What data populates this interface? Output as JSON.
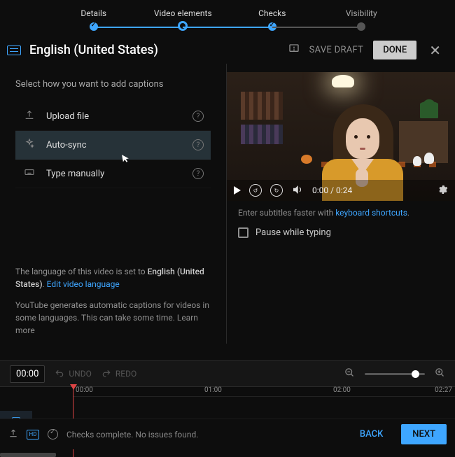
{
  "stepper": {
    "steps": [
      {
        "label": "Details",
        "state": "done"
      },
      {
        "label": "Video elements",
        "state": "current"
      },
      {
        "label": "Checks",
        "state": "done"
      },
      {
        "label": "Visibility",
        "state": "pending"
      }
    ]
  },
  "header": {
    "title": "English (United States)",
    "save_draft": "SAVE DRAFT",
    "done": "DONE"
  },
  "left": {
    "instruction": "Select how you want to add captions",
    "options": {
      "upload": "Upload file",
      "autosync": "Auto-sync",
      "manual": "Type manually"
    },
    "lang_note_prefix": "The language of this video is set to ",
    "lang_note_lang": "English (United States)",
    "lang_note_period": ". ",
    "lang_note_link": "Edit video language",
    "gen_note_text": "YouTube generates automatic captions for videos in some languages. This can take some time. ",
    "gen_note_link": "Learn more"
  },
  "player": {
    "time": "0:00 / 0:24",
    "enter_faster_prefix": "Enter subtitles faster with ",
    "enter_faster_link": "keyboard shortcuts",
    "enter_faster_suffix": ".",
    "pause_label": "Pause while typing"
  },
  "editbar": {
    "timecode": "00:00",
    "undo": "UNDO",
    "redo": "REDO"
  },
  "timeline": {
    "ticks": {
      "t0": "00:00",
      "t1": "01:00",
      "t2": "02:00",
      "tend": "02:27"
    }
  },
  "footer": {
    "checks_text": "Checks complete. No issues found.",
    "back": "BACK",
    "next": "NEXT",
    "hd": "HD"
  }
}
